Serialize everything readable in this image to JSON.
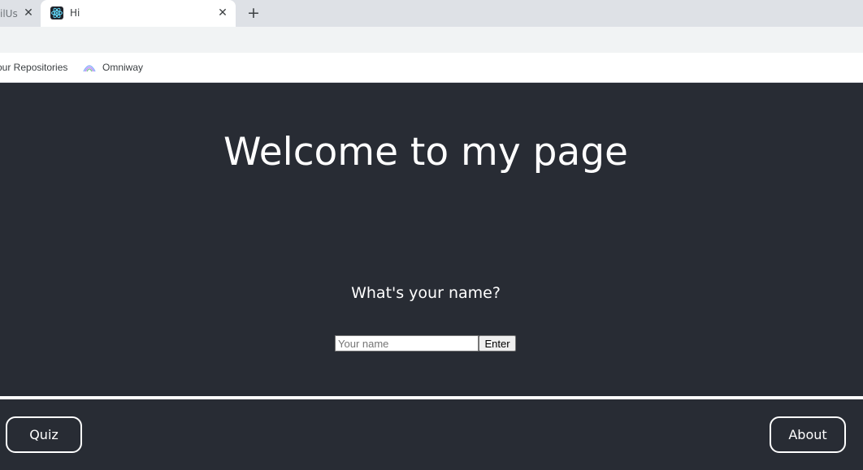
{
  "browser": {
    "previous_tab": {
      "title": "ilUs"
    },
    "active_tab": {
      "title": "Hi",
      "favicon": "react-icon"
    },
    "new_tab_symbol": "+",
    "close_symbol": "✕",
    "bookmarks": [
      {
        "label": "our Repositories"
      },
      {
        "label": "Omniway",
        "icon": "omniway-icon"
      }
    ]
  },
  "page": {
    "heading": "Welcome to my page",
    "question": "What's your name?",
    "name_input": {
      "placeholder": "Your name",
      "value": ""
    },
    "enter_label": "Enter",
    "nav": {
      "quiz_label": "Quiz",
      "about_label": "About"
    }
  },
  "colors": {
    "page_background": "#282c34",
    "text": "#ffffff",
    "tabstrip": "#dee1e6",
    "toolbar": "#f1f3f4"
  }
}
